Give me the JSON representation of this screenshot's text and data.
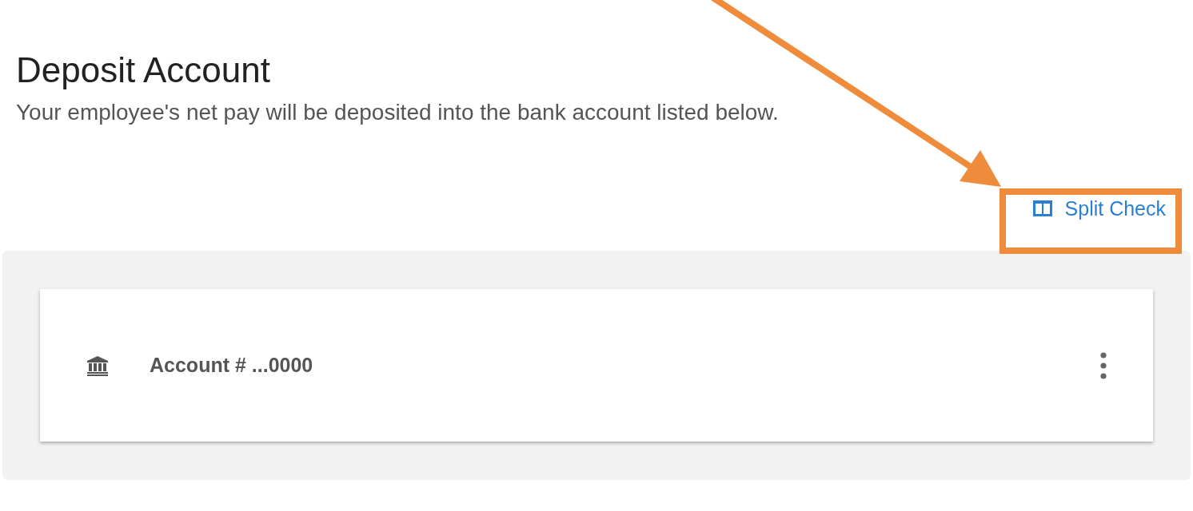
{
  "title": "Deposit Account",
  "subtitle": "Your employee's net pay will be deposited into the bank account listed below.",
  "split_button": {
    "label": "Split Check"
  },
  "accounts": [
    {
      "label": "Account # ...0000"
    }
  ]
}
